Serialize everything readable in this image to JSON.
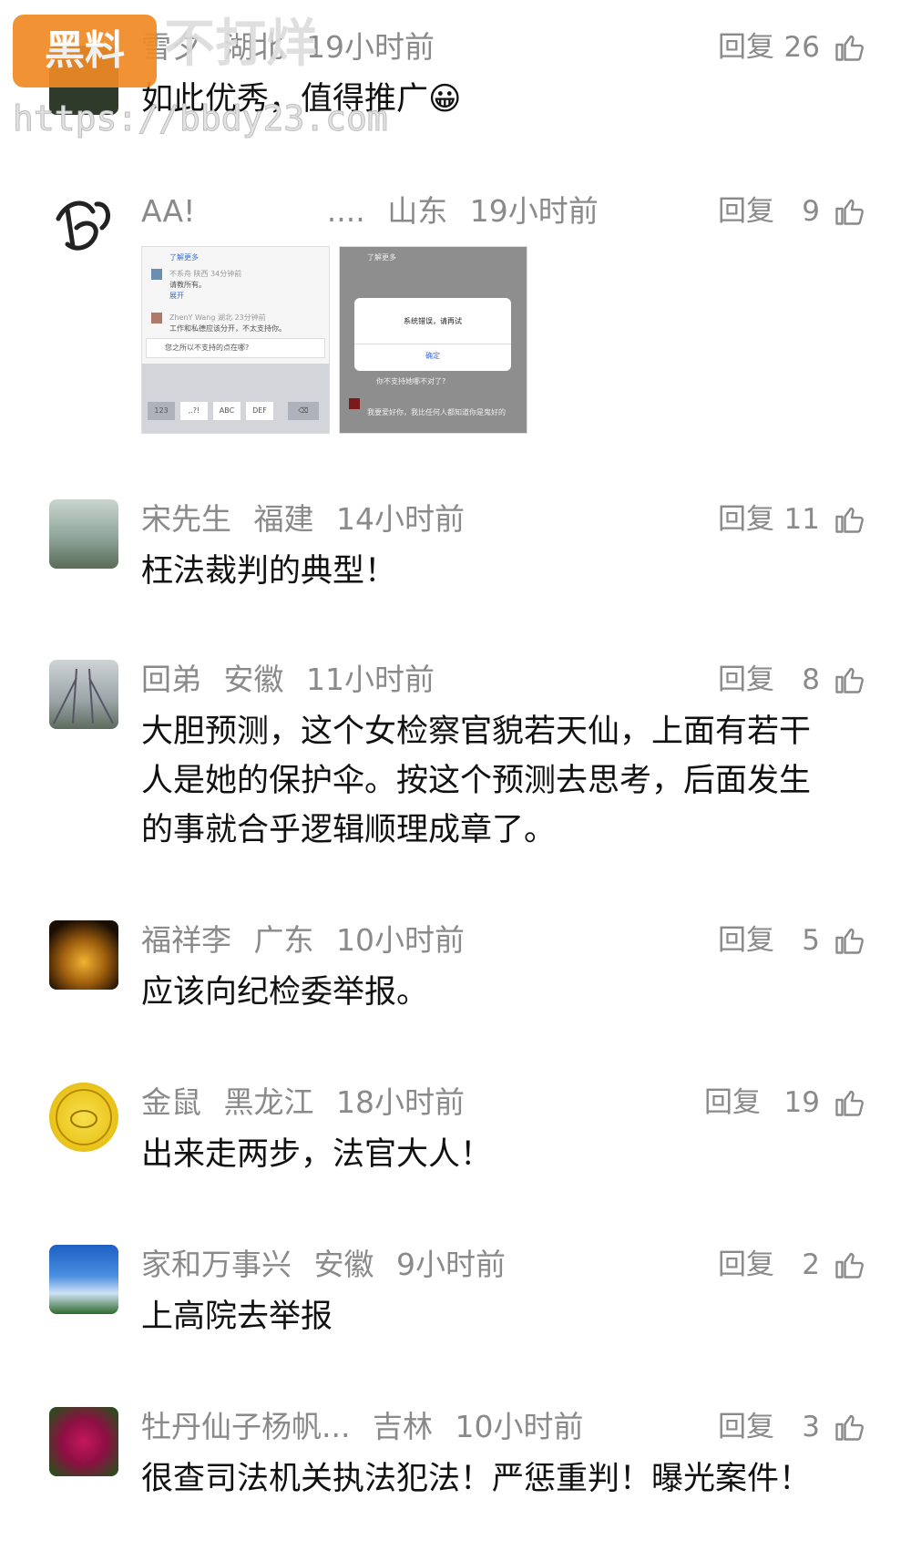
{
  "watermark": {
    "badge": "黑料",
    "title": "不打烊",
    "url": "https://bbdy23.com"
  },
  "comments": [
    {
      "name": "雪夕",
      "region": "湖北",
      "time": "19小时前",
      "reply": "回复",
      "likes": "26",
      "text": "如此优秀，值得推广😀"
    },
    {
      "name": "AA!",
      "region": "山东",
      "time": "19小时前",
      "reply": "回复",
      "likes": "9",
      "text": "",
      "ellipsis": "....",
      "screens": [
        {
          "top": "了解更多",
          "r1": "不系舟 陕西 34分钟前",
          "r1b": "请教所有。",
          "r1c": "展开",
          "r2": "ZhenY Wang 湖北 23分钟前",
          "r2b": "工作和私德应该分开，不太支持你。",
          "input": "您之所以不支持的点在哪?",
          "keys": [
            "123",
            ",.?!",
            "ABC",
            "DEF"
          ]
        },
        {
          "top": "了解更多",
          "dialog": "系统错误，请再试",
          "ok": "确定",
          "r3": "你不支持她哪不对了?",
          "r4": "我要爱好你，我比任何人都知道你是鬼好的"
        }
      ]
    },
    {
      "name": "宋先生",
      "region": "福建",
      "time": "14小时前",
      "reply": "回复",
      "likes": "11",
      "text": "枉法裁判的典型！"
    },
    {
      "name": "回弟",
      "region": "安徽",
      "time": "11小时前",
      "reply": "回复",
      "likes": "8",
      "text": "大胆预测，这个女检察官貌若天仙，上面有若干人是她的保护伞。按这个预测去思考，后面发生的事就合乎逻辑顺理成章了。"
    },
    {
      "name": "福祥李",
      "region": "广东",
      "time": "10小时前",
      "reply": "回复",
      "likes": "5",
      "text": "应该向纪检委举报。"
    },
    {
      "name": "金鼠",
      "region": "黑龙江",
      "time": "18小时前",
      "reply": "回复",
      "likes": "19",
      "text": "出来走两步，法官大人！"
    },
    {
      "name": "家和万事兴",
      "region": "安徽",
      "time": "9小时前",
      "reply": "回复",
      "likes": "2",
      "text": "上高院去举报"
    },
    {
      "name": "牡丹仙子杨帆...",
      "region": "吉林",
      "time": "10小时前",
      "reply": "回复",
      "likes": "3",
      "text": "很查司法机关执法犯法！严惩重判！曝光案件！"
    }
  ],
  "colors": {
    "meta": "#8a8a8a",
    "text": "#111111",
    "badge": "#f08a24"
  },
  "icons": {
    "like": "thumbs-up-icon"
  }
}
